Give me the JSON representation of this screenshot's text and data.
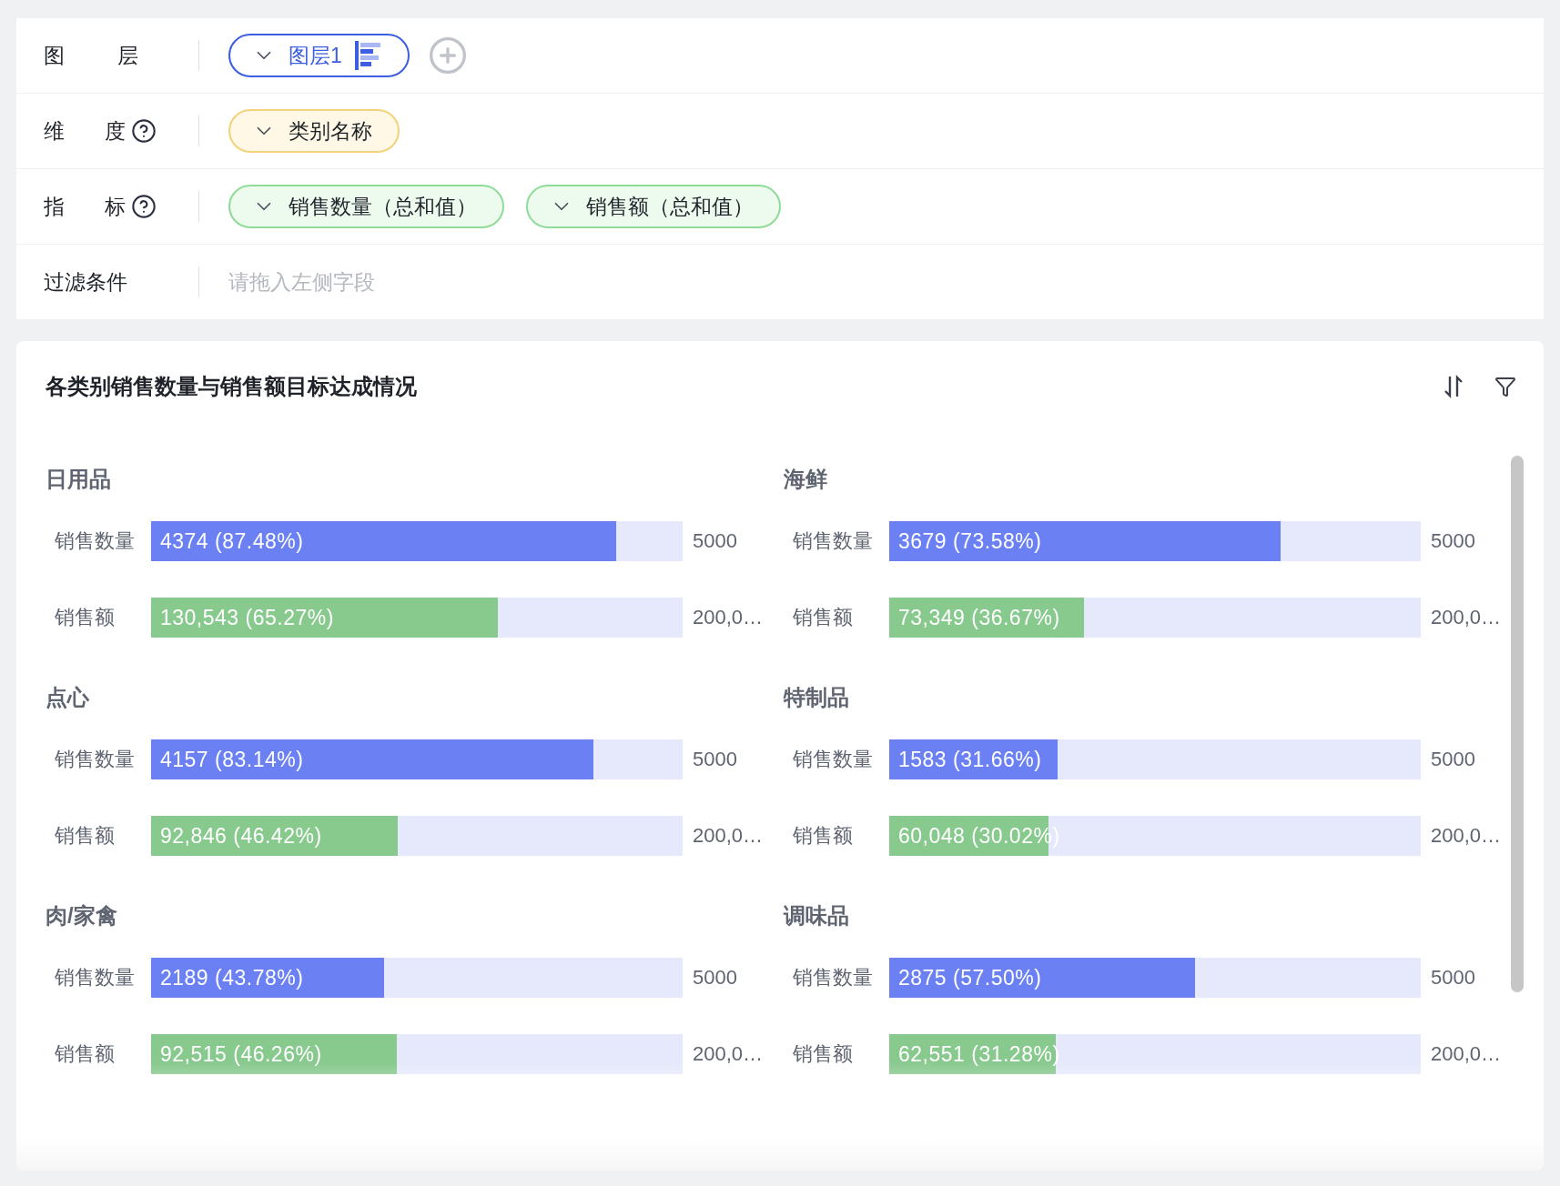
{
  "config_rows": [
    {
      "label": "图 层",
      "help": false,
      "pills": [
        {
          "kind": "layer",
          "text": "图层1"
        }
      ],
      "add_button": true
    },
    {
      "label": "维 度",
      "help": true,
      "pills": [
        {
          "kind": "dimension",
          "text": "类别名称"
        }
      ],
      "add_button": false
    },
    {
      "label": "指 标",
      "help": true,
      "pills": [
        {
          "kind": "measure",
          "text": "销售数量（总和值）"
        },
        {
          "kind": "measure",
          "text": "销售额（总和值）"
        }
      ],
      "add_button": false
    },
    {
      "label": "过滤条件",
      "help": false,
      "placeholder": "请拖入左侧字段",
      "pills": [],
      "add_button": false
    }
  ],
  "chart": {
    "title": "各类别销售数量与销售额目标达成情况",
    "categories": [
      {
        "name": "日用品",
        "metrics": [
          {
            "name": "销售数量",
            "value": "4374 (87.48%)",
            "level": 0.8748,
            "color": "#6b80f2",
            "target": "5000"
          },
          {
            "name": "销售额",
            "value": "130,543 (65.27%)",
            "level": 0.6527,
            "color": "#88c98e",
            "target": "200,0…"
          }
        ]
      },
      {
        "name": "海鲜",
        "metrics": [
          {
            "name": "销售数量",
            "value": "3679 (73.58%)",
            "level": 0.7358,
            "color": "#6b80f2",
            "target": "5000"
          },
          {
            "name": "销售额",
            "value": "73,349 (36.67%)",
            "level": 0.3667,
            "color": "#88c98e",
            "target": "200,0…"
          }
        ]
      },
      {
        "name": "点心",
        "metrics": [
          {
            "name": "销售数量",
            "value": "4157 (83.14%)",
            "level": 0.8314,
            "color": "#6b80f2",
            "target": "5000"
          },
          {
            "name": "销售额",
            "value": "92,846 (46.42%)",
            "level": 0.4642,
            "color": "#88c98e",
            "target": "200,0…"
          }
        ]
      },
      {
        "name": "特制品",
        "metrics": [
          {
            "name": "销售数量",
            "value": "1583 (31.66%)",
            "level": 0.3166,
            "color": "#6b80f2",
            "target": "5000"
          },
          {
            "name": "销售额",
            "value": "60,048 (30.02%)",
            "level": 0.3002,
            "color": "#88c98e",
            "target": "200,0…"
          }
        ]
      },
      {
        "name": "肉/家禽",
        "metrics": [
          {
            "name": "销售数量",
            "value": "2189 (43.78%)",
            "level": 0.4378,
            "color": "#6b80f2",
            "target": "5000"
          },
          {
            "name": "销售额",
            "value": "92,515 (46.26%)",
            "level": 0.4626,
            "color": "#88c98e",
            "target": "200,0…"
          }
        ]
      },
      {
        "name": "调味品",
        "metrics": [
          {
            "name": "销售数量",
            "value": "2875 (57.50%)",
            "level": 0.575,
            "color": "#6b80f2",
            "target": "5000"
          },
          {
            "name": "销售额",
            "value": "62,551 (31.28%)",
            "level": 0.3128,
            "color": "#88c98e",
            "target": "200,0…"
          }
        ]
      }
    ]
  }
}
